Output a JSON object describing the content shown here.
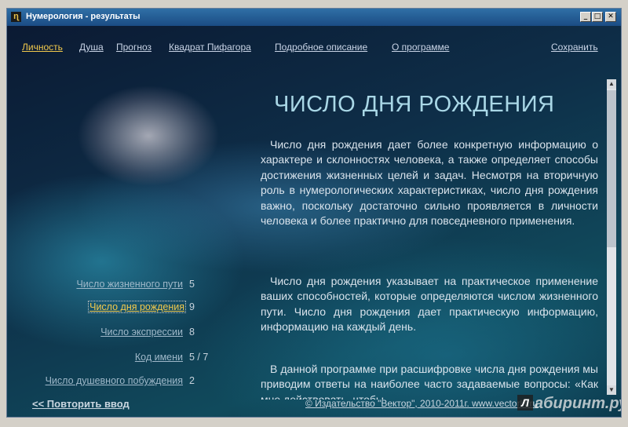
{
  "window": {
    "title": "Нумерология - результаты",
    "app_icon": "numerology-app-icon",
    "controls": {
      "minimize": "_",
      "maximize": "□",
      "close": "✕"
    }
  },
  "nav": {
    "items": [
      {
        "label": "Личность",
        "active": true
      },
      {
        "label": "Душа"
      },
      {
        "label": "Прогноз"
      },
      {
        "label": "Квадрат Пифагора"
      },
      {
        "label": "Подробное описание"
      },
      {
        "label": "О программе"
      }
    ],
    "save_label": "Сохранить"
  },
  "main": {
    "heading": "ЧИСЛО ДНЯ РОЖДЕНИЯ",
    "paragraphs": [
      "Число дня рождения дает более конкретную информацию о характере и склонностях человека, а также определяет способы достижения жизненных целей и задач. Несмотря на вторичную роль в нумерологических характеристиках, число дня рождения важно, поскольку достаточно сильно проявляется в личности человека и более практично для повседневного применения.",
      "Число дня рождения указывает на практическое применение ваших способностей, которые определяются числом жизненного пути. Число дня рождения дает практическую информацию, информацию на каждый день.",
      "В данной программе при расшифровке числа дня рождения мы приводим ответы на наиболее часто задаваемые вопросы: «Как мне действовать, чтобы"
    ]
  },
  "sidebar": {
    "items": [
      {
        "label": "Число жизненного пути",
        "value": "5"
      },
      {
        "label": "Число дня рождения",
        "value": "9",
        "active": true
      },
      {
        "label": "Число экспрессии",
        "value": "8"
      },
      {
        "label": "Код имени",
        "value": "5 / 7"
      },
      {
        "label": "Число душевного побуждения",
        "value": "2"
      }
    ]
  },
  "footer": {
    "repeat_label": "<< Повторить ввод",
    "copyright": "© Издательство \"Вектор\", 2010-2011г. www.vectorlit.ru"
  },
  "watermark": {
    "badge": "Л",
    "text": "абиринт.ру"
  },
  "scrollbar": {
    "up": "▲",
    "down": "▼"
  }
}
